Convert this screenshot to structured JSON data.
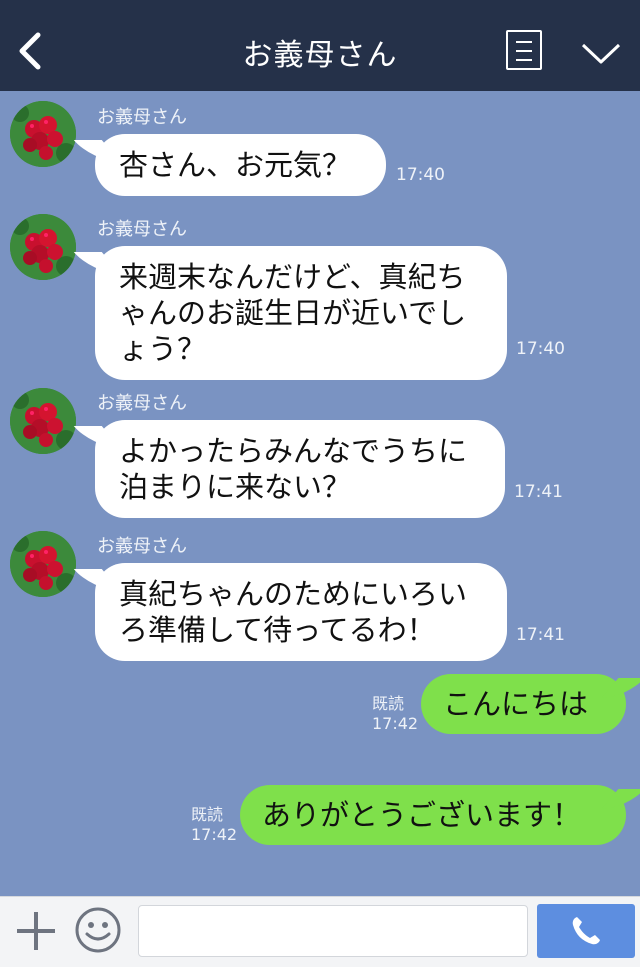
{
  "header": {
    "title": "お義母さん",
    "icons": [
      "chevron-left-icon",
      "menu-icon",
      "chevron-down-icon"
    ]
  },
  "messages": [
    {
      "sender": "お義母さん",
      "lines": [
        "杏さん、お元気？"
      ],
      "time": "17:40"
    },
    {
      "sender": "お義母さん",
      "lines": [
        "来週末なんだけど、真紀ち",
        "ゃんのお誕生日が近いでし",
        "ょう？"
      ],
      "time": "17:40"
    },
    {
      "sender": "お義母さん",
      "lines": [
        "よかったらみんなでうちに",
        "泊まりに来ない？"
      ],
      "time": "17:41"
    },
    {
      "sender": "お義母さん",
      "lines": [
        "真紀ちゃんのためにいろい",
        "ろ準備して待ってるわ！"
      ],
      "time": "17:41"
    }
  ],
  "replies": [
    {
      "text": "こんにちは",
      "read": "既読",
      "time": "17:42"
    },
    {
      "text": "ありがとうございます！",
      "read": "既読",
      "time": "17:42"
    }
  ],
  "input": {
    "value": "",
    "placeholder": ""
  },
  "colors": {
    "header": "#253149",
    "chat_background": "#7a93c2",
    "outgoing_bubble": "#7fe04b",
    "incoming_bubble": "#ffffff",
    "call_button": "#5d8ee0"
  }
}
